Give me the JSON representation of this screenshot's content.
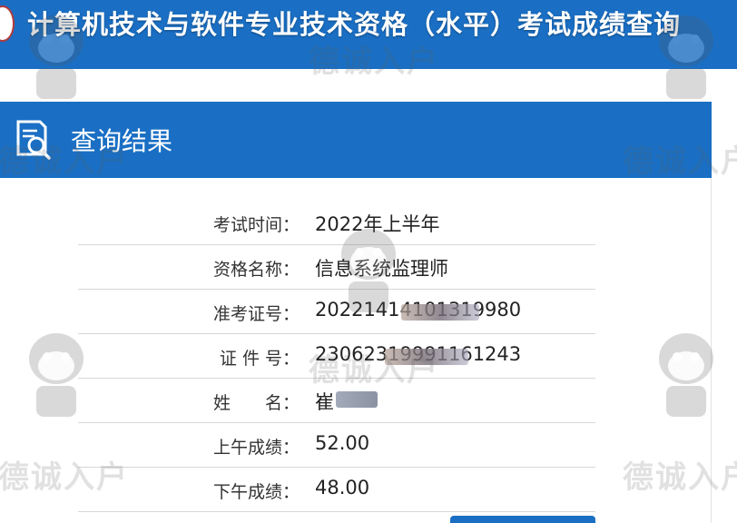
{
  "header": {
    "title": "计算机技术与软件专业技术资格（水平）考试成绩查询"
  },
  "result": {
    "title": "查询结果",
    "rows": [
      {
        "label": "考试时间：",
        "value": "2022年上半年"
      },
      {
        "label": "资格名称：",
        "value": "信息系统监理师"
      },
      {
        "label": "准考证号：",
        "value": "20221414101319980"
      },
      {
        "label": "证 件 号：",
        "value": "23062319991161243"
      },
      {
        "label": "姓　　名：",
        "value": "崔"
      },
      {
        "label": "上午成绩：",
        "value": "52.00"
      },
      {
        "label": "下午成绩：",
        "value": "48.00"
      }
    ]
  },
  "watermark": {
    "text": "德诚入户"
  },
  "colors": {
    "brand_blue": "#1a6fc4",
    "text": "#333333"
  }
}
